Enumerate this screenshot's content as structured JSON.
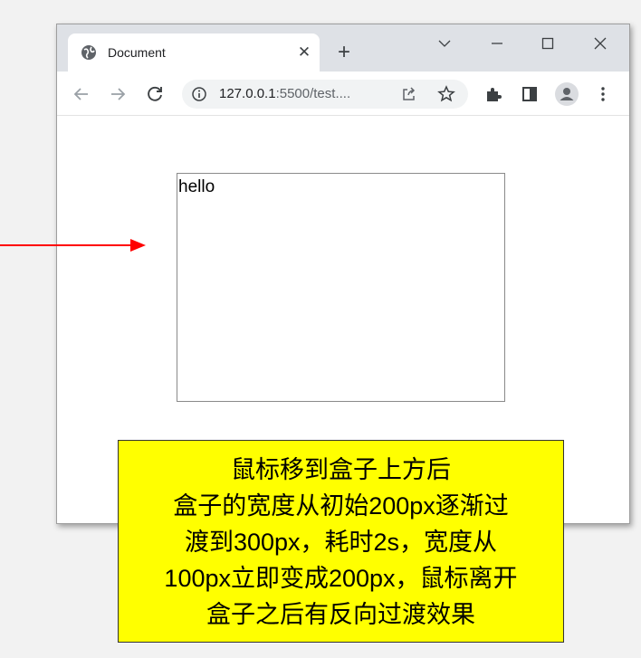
{
  "browser": {
    "tab": {
      "title": "Document",
      "favicon": "globe-icon",
      "close_glyph": "✕"
    },
    "new_tab_glyph": "+",
    "window_controls": [
      "chevron-down-icon",
      "minimize-icon",
      "maximize-icon",
      "close-icon"
    ],
    "toolbar": {
      "nav_icons": [
        "back-arrow-icon",
        "forward-arrow-icon",
        "reload-icon"
      ],
      "address": {
        "host": "127.0.0.1",
        "rest": ":5500/test...."
      },
      "right_icons": [
        "extensions-icon",
        "side-panel-icon",
        "profile-icon",
        "kebab-menu-icon"
      ]
    }
  },
  "page": {
    "box_text": "hello"
  },
  "annotation": {
    "arrow_color": "#ff0000",
    "note_bg": "#ffff00",
    "lines": [
      "鼠标移到盒子上方后",
      "盒子的宽度从初始200px逐渐过",
      "渡到300px，耗时2s，宽度从",
      "100px立即变成200px，鼠标离开",
      "盒子之后有反向过渡效果"
    ]
  }
}
